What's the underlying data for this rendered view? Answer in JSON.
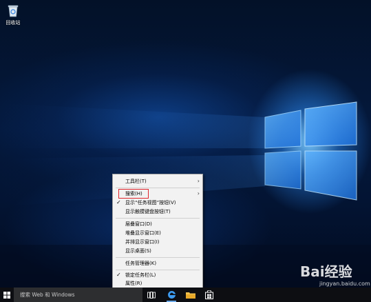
{
  "desktop": {
    "icons": [
      {
        "label": "回收站",
        "icon": "recycle-bin-icon"
      }
    ]
  },
  "context_menu": {
    "items": [
      {
        "label": "工具栏(T)",
        "submenu": true,
        "checked": false
      },
      {
        "label": "搜索(H)",
        "submenu": true,
        "checked": false,
        "highlighted": true
      },
      {
        "label": "显示“任务视图”按钮(V)",
        "submenu": false,
        "checked": true
      },
      {
        "label": "显示触摸键盘按钮(T)",
        "submenu": false,
        "checked": false
      },
      {
        "label": "层叠窗口(D)",
        "submenu": false,
        "checked": false
      },
      {
        "label": "堆叠显示窗口(E)",
        "submenu": false,
        "checked": false
      },
      {
        "label": "并排显示窗口(I)",
        "submenu": false,
        "checked": false
      },
      {
        "label": "显示桌面(S)",
        "submenu": false,
        "checked": false
      },
      {
        "label": "任务管理器(K)",
        "submenu": false,
        "checked": false
      },
      {
        "label": "锁定任务栏(L)",
        "submenu": false,
        "checked": true
      },
      {
        "label": "属性(R)",
        "submenu": false,
        "checked": false
      }
    ],
    "highlight_color": "#e0242b"
  },
  "taskbar": {
    "search_placeholder": "搜索 Web 和 Windows",
    "icons": [
      "windows-start-icon",
      "task-view-icon",
      "edge-browser-icon",
      "file-explorer-icon",
      "store-icon"
    ]
  },
  "watermark": {
    "brand": "Bai经验",
    "site": "jingyan.baidu.com"
  },
  "colors": {
    "accent": "#2f7fe0",
    "taskbar_bg": "#0d0e12",
    "menu_bg": "#f2f2f2"
  }
}
